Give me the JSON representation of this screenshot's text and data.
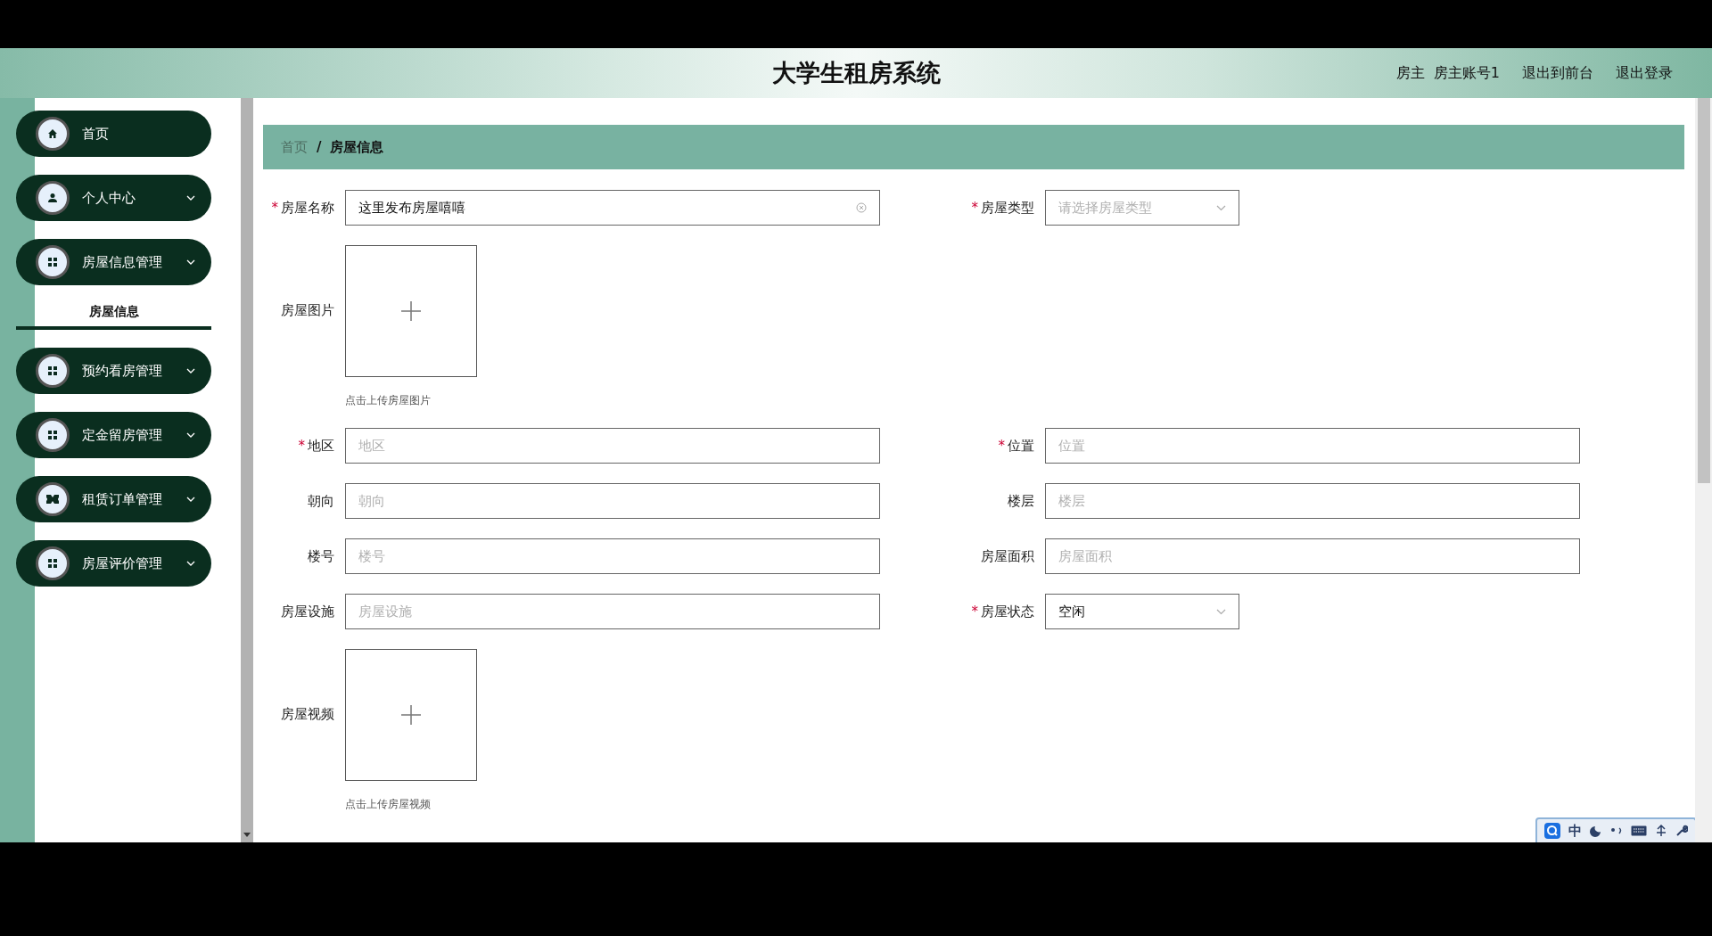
{
  "header": {
    "title": "大学生租房系统",
    "user_role": "房主",
    "user_name": "房主账号1",
    "links": [
      "退出到前台",
      "退出登录"
    ]
  },
  "sidebar": {
    "items": [
      {
        "label": "首页",
        "kind": "home",
        "expandable": false
      },
      {
        "label": "个人中心",
        "kind": "user",
        "expandable": true
      },
      {
        "label": "房屋信息管理",
        "kind": "grid",
        "expandable": true,
        "children": [
          {
            "label": "房屋信息",
            "selected": true
          }
        ]
      },
      {
        "label": "预约看房管理",
        "kind": "grid",
        "expandable": true
      },
      {
        "label": "定金留房管理",
        "kind": "grid",
        "expandable": true
      },
      {
        "label": "租赁订单管理",
        "kind": "ticket",
        "expandable": true
      },
      {
        "label": "房屋评价管理",
        "kind": "grid",
        "expandable": true
      }
    ]
  },
  "breadcrumb": {
    "items": [
      "首页",
      "房屋信息"
    ],
    "separator": "/"
  },
  "form": {
    "rows": [
      [
        {
          "kind": "text",
          "label": "房屋名称",
          "required_mark": "*",
          "value": "这里发布房屋嘻嘻",
          "clearable": true
        },
        {
          "kind": "select",
          "label": "房屋类型",
          "required_mark": "*",
          "placeholder": "请选择房屋类型"
        }
      ],
      [
        {
          "kind": "upload",
          "label": "房屋图片",
          "hint": "点击上传房屋图片"
        }
      ],
      [
        {
          "kind": "text",
          "label": "地区",
          "required_mark": "*",
          "placeholder": "地区"
        },
        {
          "kind": "text",
          "label": "位置",
          "required_mark": "*",
          "placeholder": "位置"
        }
      ],
      [
        {
          "kind": "text",
          "label": "朝向",
          "placeholder": "朝向"
        },
        {
          "kind": "text",
          "label": "楼层",
          "placeholder": "楼层"
        }
      ],
      [
        {
          "kind": "text",
          "label": "楼号",
          "placeholder": "楼号"
        },
        {
          "kind": "text",
          "label": "房屋面积",
          "placeholder": "房屋面积"
        }
      ],
      [
        {
          "kind": "text",
          "label": "房屋设施",
          "placeholder": "房屋设施"
        },
        {
          "kind": "select",
          "label": "房屋状态",
          "required_mark": "*",
          "value": "空闲"
        }
      ],
      [
        {
          "kind": "upload",
          "label": "房屋视频",
          "hint": "点击上传房屋视频"
        }
      ]
    ]
  },
  "ime_toolbar": {
    "mode": "中"
  }
}
